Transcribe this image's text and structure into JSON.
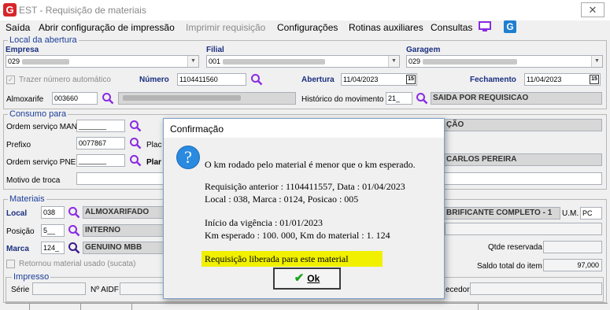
{
  "window": {
    "title": "EST - Requisição de materiais",
    "close_glyph": "✕",
    "app_icon_glyph": "G"
  },
  "menu": {
    "items": [
      {
        "label": "Saída",
        "enabled": true
      },
      {
        "label": "Abrir configuração de impressão",
        "enabled": true
      },
      {
        "label": "Imprimir requisição",
        "enabled": false
      },
      {
        "label": "Configurações",
        "enabled": true
      },
      {
        "label": "Rotinas auxiliares",
        "enabled": true
      },
      {
        "label": "Consultas",
        "enabled": true
      }
    ],
    "icons": [
      "monitor-icon",
      "g-icon"
    ],
    "g_glyph": "G"
  },
  "local_abertura": {
    "legend": "Local da abertura",
    "empresa_label": "Empresa",
    "empresa_value": "029",
    "filial_label": "Filial",
    "filial_value": "001",
    "garagem_label": "Garagem",
    "garagem_value": "029",
    "trazer_label": "Trazer número automático",
    "numero_label": "Número",
    "numero_value": "1104411560",
    "abertura_label": "Abertura",
    "abertura_value": "11/04/2023",
    "fechamento_label": "Fechamento",
    "fechamento_value": "11/04/2023",
    "almoxarife_label": "Almoxarife",
    "almoxarife_value": "003660",
    "historico_label": "Histórico do movimento",
    "historico_code": "21_",
    "historico_desc": "SAIDA POR REQUISICAO",
    "cal_glyph": "15"
  },
  "consumo": {
    "legend": "Consumo para",
    "os_man_label": "Ordem serviço MAN",
    "os_man_value": "_______",
    "prefixo_label": "Prefixo",
    "prefixo_value": "0077867",
    "placa_label": "Plac",
    "os_pne_label": "Ordem serviço PNE",
    "os_pne_value": "_______",
    "plan_label": "Plar",
    "motivo_label": "Motivo de troca",
    "right_text_1": "ÇÃO",
    "right_text_2": "CARLOS PEREIRA"
  },
  "materiais": {
    "legend": "Materiais",
    "local_label": "Local",
    "local_code": "038",
    "local_desc": "ALMOXARIFADO",
    "posicao_label": "Posição",
    "posicao_code": "5__",
    "posicao_desc": "INTERNO",
    "marca_label": "Marca",
    "marca_code": "124_",
    "marca_desc": "GENUINO MBB",
    "retornou_label": "Retornou material usado (sucata)",
    "item_desc": "BRIFICANTE COMPLETO - 1",
    "um_label": "U.M.",
    "um_value": "PC",
    "qtde_label": "Qtde reservada",
    "saldo_label": "Saldo total do item",
    "saldo_value": "97,000"
  },
  "impresso": {
    "legend": "Impresso",
    "serie_label": "Série",
    "aidf_label": "Nº AIDF",
    "fornecedor_label": "ecedor"
  },
  "dialog": {
    "title": "Confirmação",
    "icon_glyph": "?",
    "message": "O km rodado pelo material é menor que o km esperado.",
    "req_anterior": "Requisição anterior : 1104411557,  Data : 01/04/2023",
    "local_line": "Local : 038,  Marca : 0124,  Posicao : 005",
    "inicio_vigencia": "Início da vigência : 01/01/2023",
    "km_line": "Km esperado : 100. 000,  Km do material : 1. 124",
    "liberada": "Requisição liberada para este material",
    "ok_label": "Ok",
    "ok_glyph": "✔"
  }
}
